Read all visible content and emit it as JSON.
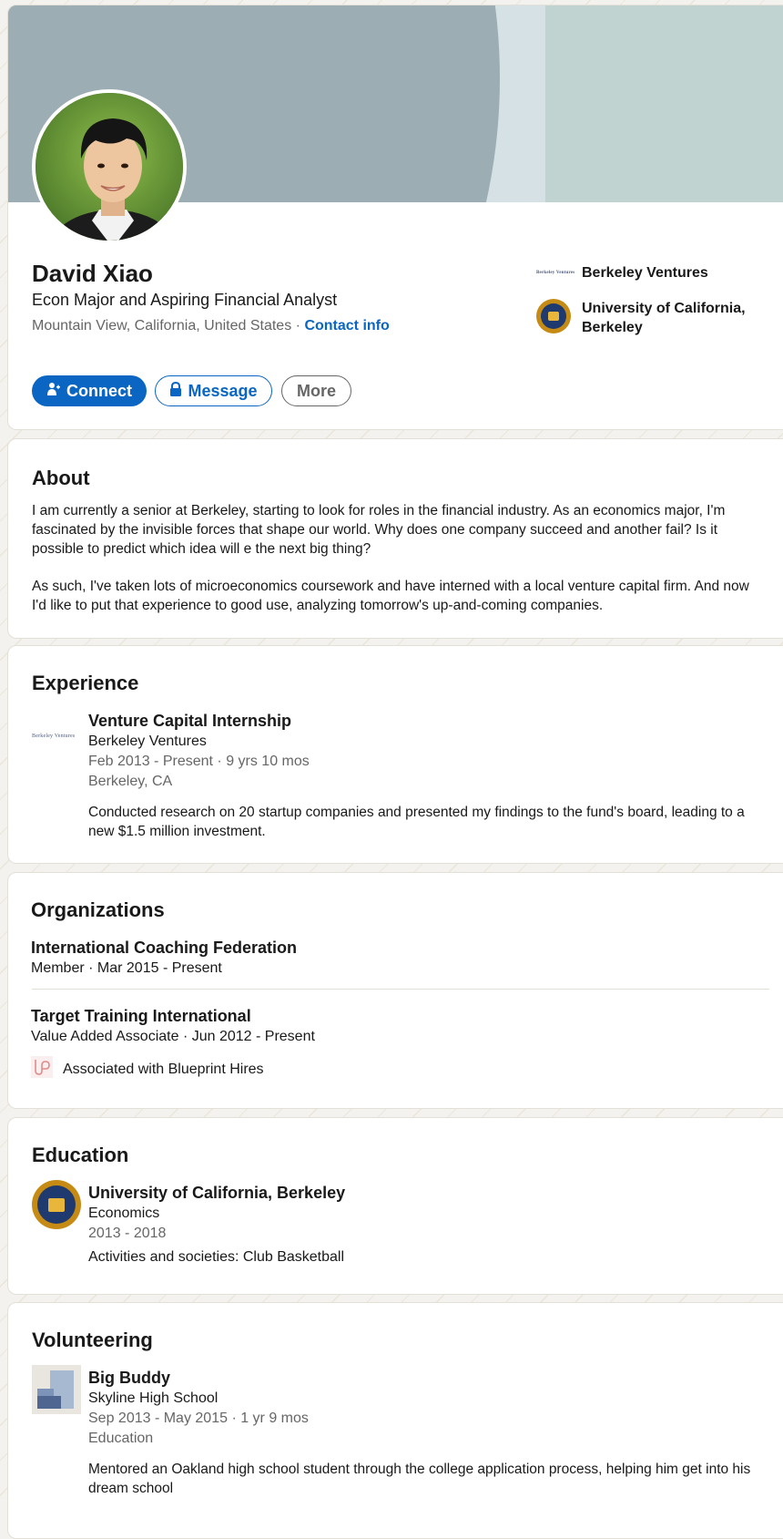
{
  "profile": {
    "name": "David Xiao",
    "headline": "Econ Major and Aspiring Financial Analyst",
    "location": "Mountain View, California, United States",
    "location_separator": "·",
    "contact_info": "Contact info",
    "buttons": {
      "connect": "Connect",
      "message": "Message",
      "more": "More"
    },
    "side_companies": [
      {
        "name": "Berkeley Ventures",
        "logo_text": "Berkeley Ventures",
        "logo": "berkeley-ventures-logo"
      },
      {
        "name": "University of California, Berkeley",
        "logo": "uc-berkeley-seal"
      }
    ]
  },
  "about": {
    "title": "About",
    "paragraphs": [
      "I am currently a senior at Berkeley, starting to look for roles in the financial industry. As an economics major, I'm fascinated by the invisible forces that shape our world. Why does one company succeed and another fail? Is it possible to predict which idea will e the next big thing?",
      "As such, I've taken lots of microeconomics coursework and have interned with a local venture capital firm. And now I'd like to put that experience to good use, analyzing tomorrow's up-and-coming companies."
    ]
  },
  "experience": {
    "title": "Experience",
    "items": [
      {
        "title": "Venture Capital Internship",
        "company": "Berkeley Ventures",
        "logo_text": "Berkeley Ventures",
        "dates": "Feb 2013 - Present · 9 yrs 10 mos",
        "location": "Berkeley, CA",
        "description": "Conducted research on 20 startup companies and presented my findings to the fund's board, leading to a new $1.5 million investment."
      }
    ]
  },
  "organizations": {
    "title": "Organizations",
    "items": [
      {
        "name": "International Coaching Federation",
        "detail": "Member · Mar 2015 - Present"
      },
      {
        "name": "Target Training International",
        "detail": "Value Added Associate · Jun 2012 - Present",
        "associated": "Associated with Blueprint Hires"
      }
    ]
  },
  "education": {
    "title": "Education",
    "items": [
      {
        "school": "University of California, Berkeley",
        "field": "Economics",
        "dates": "2013 - 2018",
        "activities": "Activities and societies: Club Basketball"
      }
    ]
  },
  "volunteering": {
    "title": "Volunteering",
    "items": [
      {
        "role": "Big Buddy",
        "org": "Skyline High School",
        "dates": "Sep 2013 - May 2015 · 1 yr 9 mos",
        "cause": "Education",
        "description": "Mentored an Oakland high school student through the college application process, helping him get into his dream school"
      }
    ]
  },
  "colors": {
    "brand_blue": "#0a66c2",
    "muted_text": "#666666",
    "banner_dark": "#9cadb3",
    "banner_light": "#c0d3d1"
  }
}
